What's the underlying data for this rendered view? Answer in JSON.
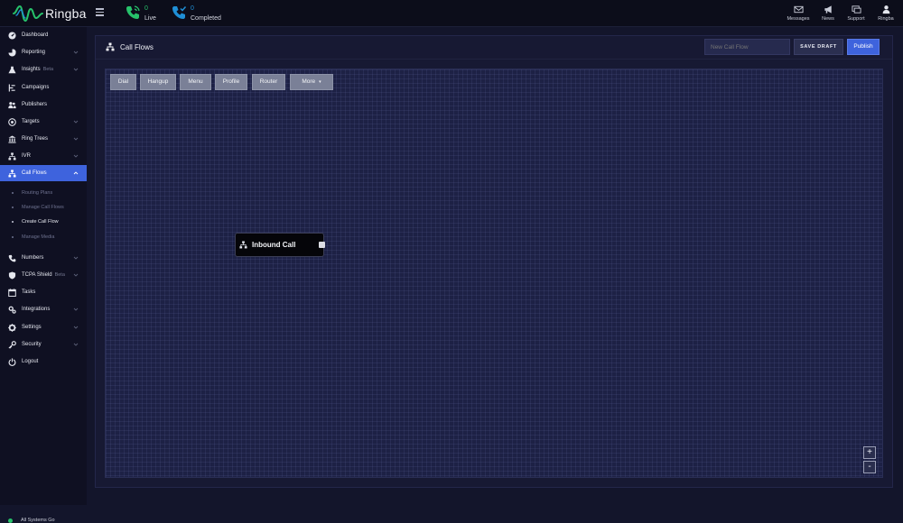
{
  "brand": {
    "name": "Ringba",
    "accent": "#27c26b"
  },
  "topbar": {
    "stats": [
      {
        "count": "0",
        "label": "Live",
        "icon": "phone-live-icon"
      },
      {
        "count": "0",
        "label": "Completed",
        "icon": "phone-completed-icon"
      }
    ],
    "actions": [
      {
        "label": "Messages",
        "icon": "envelope-icon"
      },
      {
        "label": "News",
        "icon": "megaphone-icon"
      },
      {
        "label": "Support",
        "icon": "support-icon"
      },
      {
        "label": "Ringba",
        "icon": "user-icon"
      }
    ]
  },
  "sidebar": {
    "items": [
      {
        "label": "Dashboard",
        "icon": "dashboard-icon",
        "chevron": false
      },
      {
        "label": "Reporting",
        "icon": "chart-icon",
        "chevron": true
      },
      {
        "label": "Insights",
        "badge": "Beta",
        "icon": "insights-icon",
        "chevron": true
      },
      {
        "label": "Campaigns",
        "icon": "campaigns-icon",
        "chevron": false
      },
      {
        "label": "Publishers",
        "icon": "publishers-icon",
        "chevron": false
      },
      {
        "label": "Targets",
        "icon": "target-icon",
        "chevron": true
      },
      {
        "label": "Ring Trees",
        "icon": "ring-tree-icon",
        "chevron": true
      },
      {
        "label": "IVR",
        "icon": "ivr-icon",
        "chevron": true
      },
      {
        "label": "Call Flows",
        "icon": "call-flows-icon",
        "chevron": true,
        "active": true
      }
    ],
    "sub_items": [
      {
        "label": "Routing Plans"
      },
      {
        "label": "Manage Call Flows"
      },
      {
        "label": "Create Call Flow",
        "current": true
      },
      {
        "label": "Manage Media"
      }
    ],
    "items_after": [
      {
        "label": "Numbers",
        "icon": "numbers-icon",
        "chevron": true
      },
      {
        "label": "TCPA Shield",
        "badge": "Beta",
        "icon": "shield-icon",
        "chevron": true
      },
      {
        "label": "Tasks",
        "icon": "tasks-icon",
        "chevron": false
      },
      {
        "label": "Integrations",
        "icon": "integrations-icon",
        "chevron": true
      },
      {
        "label": "Settings",
        "icon": "settings-icon",
        "chevron": true
      },
      {
        "label": "Security",
        "icon": "key-icon",
        "chevron": true
      },
      {
        "label": "Logout",
        "icon": "logout-icon",
        "chevron": false
      }
    ],
    "status": "All Systems Go"
  },
  "panel": {
    "title": "Call Flows",
    "flow_name_placeholder": "New Call Flow",
    "save_draft": "SAVE DRAFT",
    "publish": "Publish"
  },
  "toolbar": {
    "buttons": [
      "Dial",
      "Hangup",
      "Menu",
      "Profile",
      "Router"
    ],
    "more": "More"
  },
  "canvas": {
    "node_label": "Inbound Call",
    "zoom_in": "+",
    "zoom_out": "-"
  }
}
